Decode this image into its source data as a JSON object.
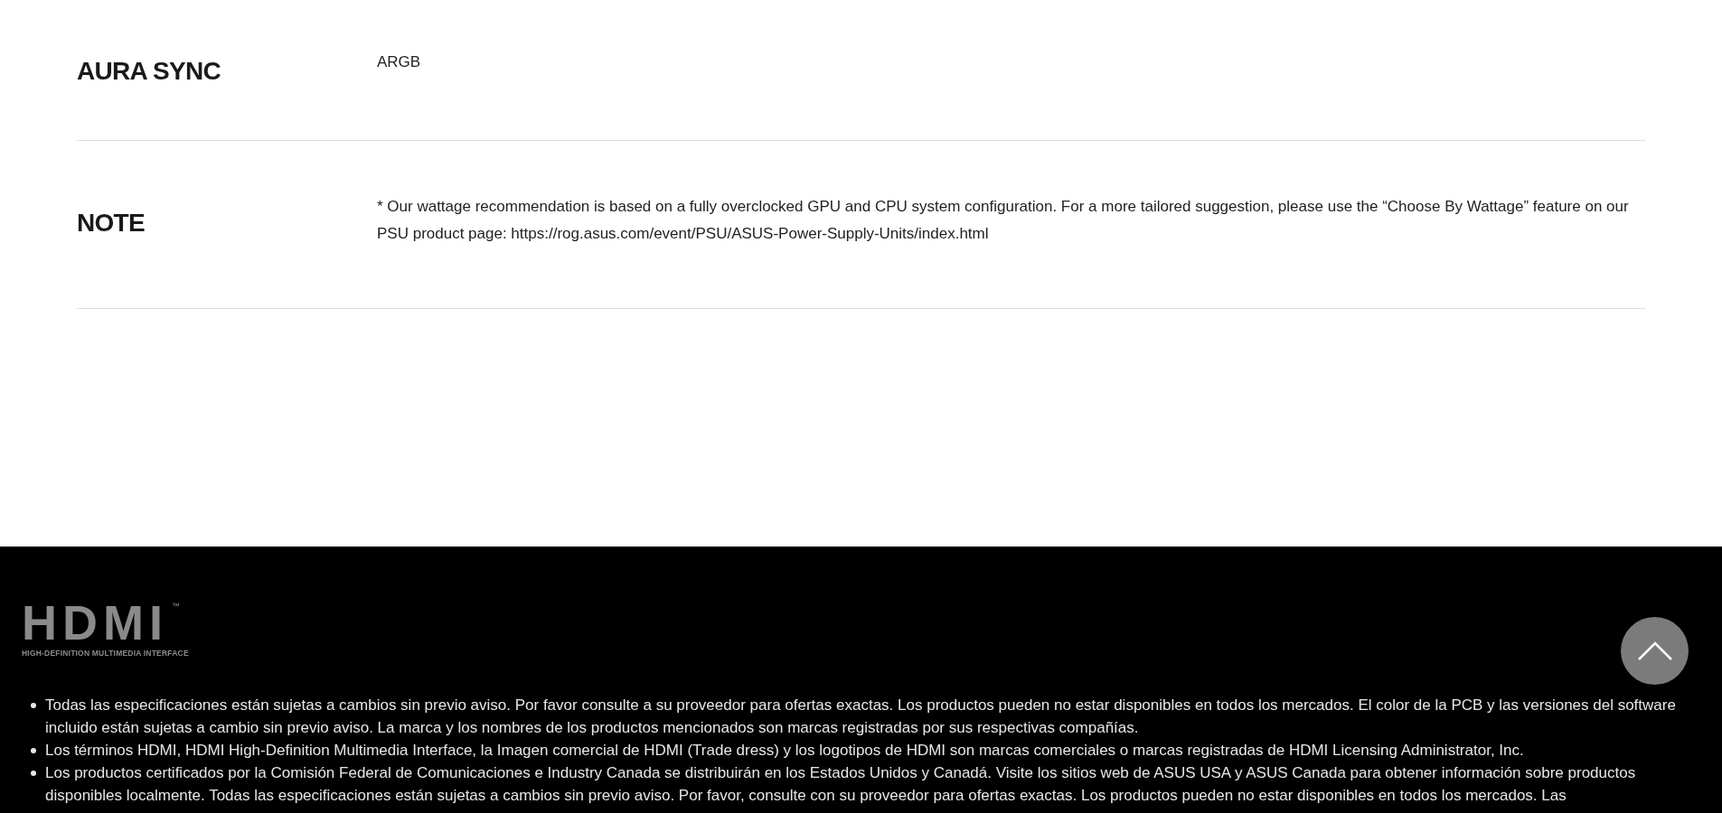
{
  "specs": [
    {
      "label": "AURA SYNC",
      "value": "ARGB"
    },
    {
      "label": "NOTE",
      "value": "* Our wattage recommendation is based on a fully overclocked GPU and CPU system configuration. For a more tailored suggestion, please use the “Choose By Wattage” feature on our PSU product page: https://rog.asus.com/event/PSU/ASUS-Power-Supply-Units/index.html"
    }
  ],
  "footer": {
    "logo": {
      "wordmark": "HDMI",
      "trademark": "™",
      "tagline": "HIGH-DEFINITION MULTIMEDIA INTERFACE"
    },
    "notes": [
      "Todas las especificaciones están sujetas a cambios sin previo aviso. Por favor consulte a su proveedor para ofertas exactas. Los productos pueden no estar disponibles en todos los mercados. El color de la PCB y las versiones del software incluido están sujetas a cambio sin previo aviso. La marca y los nombres de los productos mencionados son marcas registradas por sus respectivas compañías.",
      "Los términos HDMI, HDMI High-Definition Multimedia Interface, la Imagen comercial de HDMI (Trade dress) y los logotipos de HDMI son marcas comerciales o marcas registradas de HDMI Licensing Administrator, Inc.",
      "Los productos certificados por la Comisión Federal de Comunicaciones e Industry Canada se distribuirán en los Estados Unidos y Canadá. Visite los sitios web de ASUS USA y ASUS Canada para obtener información sobre productos disponibles localmente. Todas las especificaciones están sujetas a cambios sin previo aviso. Por favor, consulte con su proveedor para ofertas exactas. Los productos pueden no estar disponibles en todos los mercados. Las"
    ]
  }
}
